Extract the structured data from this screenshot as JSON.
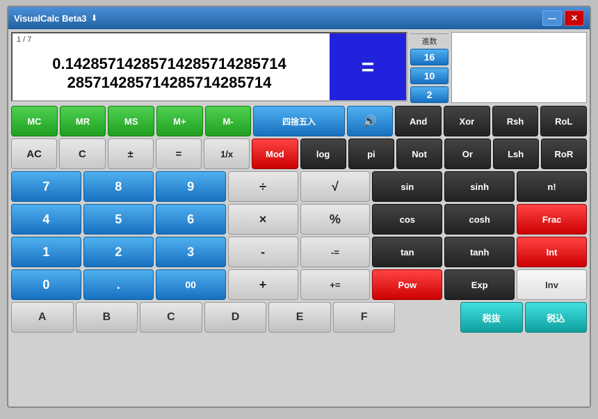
{
  "window": {
    "title": "VisualCalc Beta3",
    "title_icon": "⬇"
  },
  "display": {
    "fraction": "1 / 7",
    "number_line1": "0.14285714285714285714285714",
    "number_line2": "285714285714285714285714"
  },
  "equals_symbol": "=",
  "memory_buttons": [
    {
      "label": "MC",
      "style": "green"
    },
    {
      "label": "MR",
      "style": "green"
    },
    {
      "label": "MS",
      "style": "green"
    },
    {
      "label": "M+",
      "style": "green"
    },
    {
      "label": "M-",
      "style": "green"
    }
  ],
  "round_button": "四捨五入",
  "speaker_button": "🔊",
  "logic_buttons_row1": [
    {
      "label": "And",
      "style": "dark"
    },
    {
      "label": "Xor",
      "style": "dark"
    },
    {
      "label": "Rsh",
      "style": "dark"
    },
    {
      "label": "RoL",
      "style": "dark"
    }
  ],
  "row2_left": [
    {
      "label": "AC",
      "style": "gray"
    },
    {
      "label": "C",
      "style": "gray"
    },
    {
      "label": "±",
      "style": "gray"
    },
    {
      "label": "=",
      "style": "gray"
    },
    {
      "label": "1/x",
      "style": "gray"
    }
  ],
  "row2_mod": {
    "label": "Mod",
    "style": "red"
  },
  "row2_log": {
    "label": "log",
    "style": "dark"
  },
  "row2_pi": {
    "label": "pi",
    "style": "dark"
  },
  "logic_buttons_row2": [
    {
      "label": "Not",
      "style": "dark"
    },
    {
      "label": "Or",
      "style": "dark"
    },
    {
      "label": "Lsh",
      "style": "dark"
    },
    {
      "label": "RoR",
      "style": "dark"
    }
  ],
  "numpad": {
    "row1": [
      {
        "label": "7",
        "style": "blue"
      },
      {
        "label": "8",
        "style": "blue"
      },
      {
        "label": "9",
        "style": "blue"
      },
      {
        "label": "÷",
        "style": "gray"
      },
      {
        "label": "√",
        "style": "gray"
      }
    ],
    "row2": [
      {
        "label": "4",
        "style": "blue"
      },
      {
        "label": "5",
        "style": "blue"
      },
      {
        "label": "6",
        "style": "blue"
      },
      {
        "label": "×",
        "style": "gray"
      },
      {
        "label": "%",
        "style": "gray"
      }
    ],
    "row3": [
      {
        "label": "1",
        "style": "blue"
      },
      {
        "label": "2",
        "style": "blue"
      },
      {
        "label": "3",
        "style": "blue"
      },
      {
        "label": "-",
        "style": "gray"
      },
      {
        "label": "-=",
        "style": "gray"
      }
    ],
    "row4": [
      {
        "label": "0",
        "style": "blue"
      },
      {
        "label": ".",
        "style": "blue"
      },
      {
        "label": "00",
        "style": "blue"
      },
      {
        "label": "+",
        "style": "gray"
      },
      {
        "label": "+=",
        "style": "gray"
      }
    ]
  },
  "trig_row1": [
    {
      "label": "sin",
      "style": "dark"
    },
    {
      "label": "sinh",
      "style": "dark"
    },
    {
      "label": "n!",
      "style": "dark"
    }
  ],
  "trig_row2": [
    {
      "label": "cos",
      "style": "dark"
    },
    {
      "label": "cosh",
      "style": "dark"
    },
    {
      "label": "Frac",
      "style": "red"
    }
  ],
  "trig_row3": [
    {
      "label": "tan",
      "style": "dark"
    },
    {
      "label": "tanh",
      "style": "dark"
    },
    {
      "label": "Int",
      "style": "red"
    }
  ],
  "trig_row4": [
    {
      "label": "Pow",
      "style": "red"
    },
    {
      "label": "Exp",
      "style": "dark"
    },
    {
      "label": "Inv",
      "style": "white"
    }
  ],
  "hex_row": [
    {
      "label": "A",
      "style": "gray"
    },
    {
      "label": "B",
      "style": "gray"
    },
    {
      "label": "C",
      "style": "gray"
    },
    {
      "label": "D",
      "style": "gray"
    },
    {
      "label": "E",
      "style": "gray"
    },
    {
      "label": "F",
      "style": "gray"
    }
  ],
  "tax_buttons": [
    {
      "label": "税抜",
      "style": "cyan"
    },
    {
      "label": "税込",
      "style": "cyan"
    }
  ],
  "sidebar": {
    "label": "進数",
    "buttons": [
      {
        "label": "16"
      },
      {
        "label": "10"
      },
      {
        "label": "2"
      }
    ]
  }
}
